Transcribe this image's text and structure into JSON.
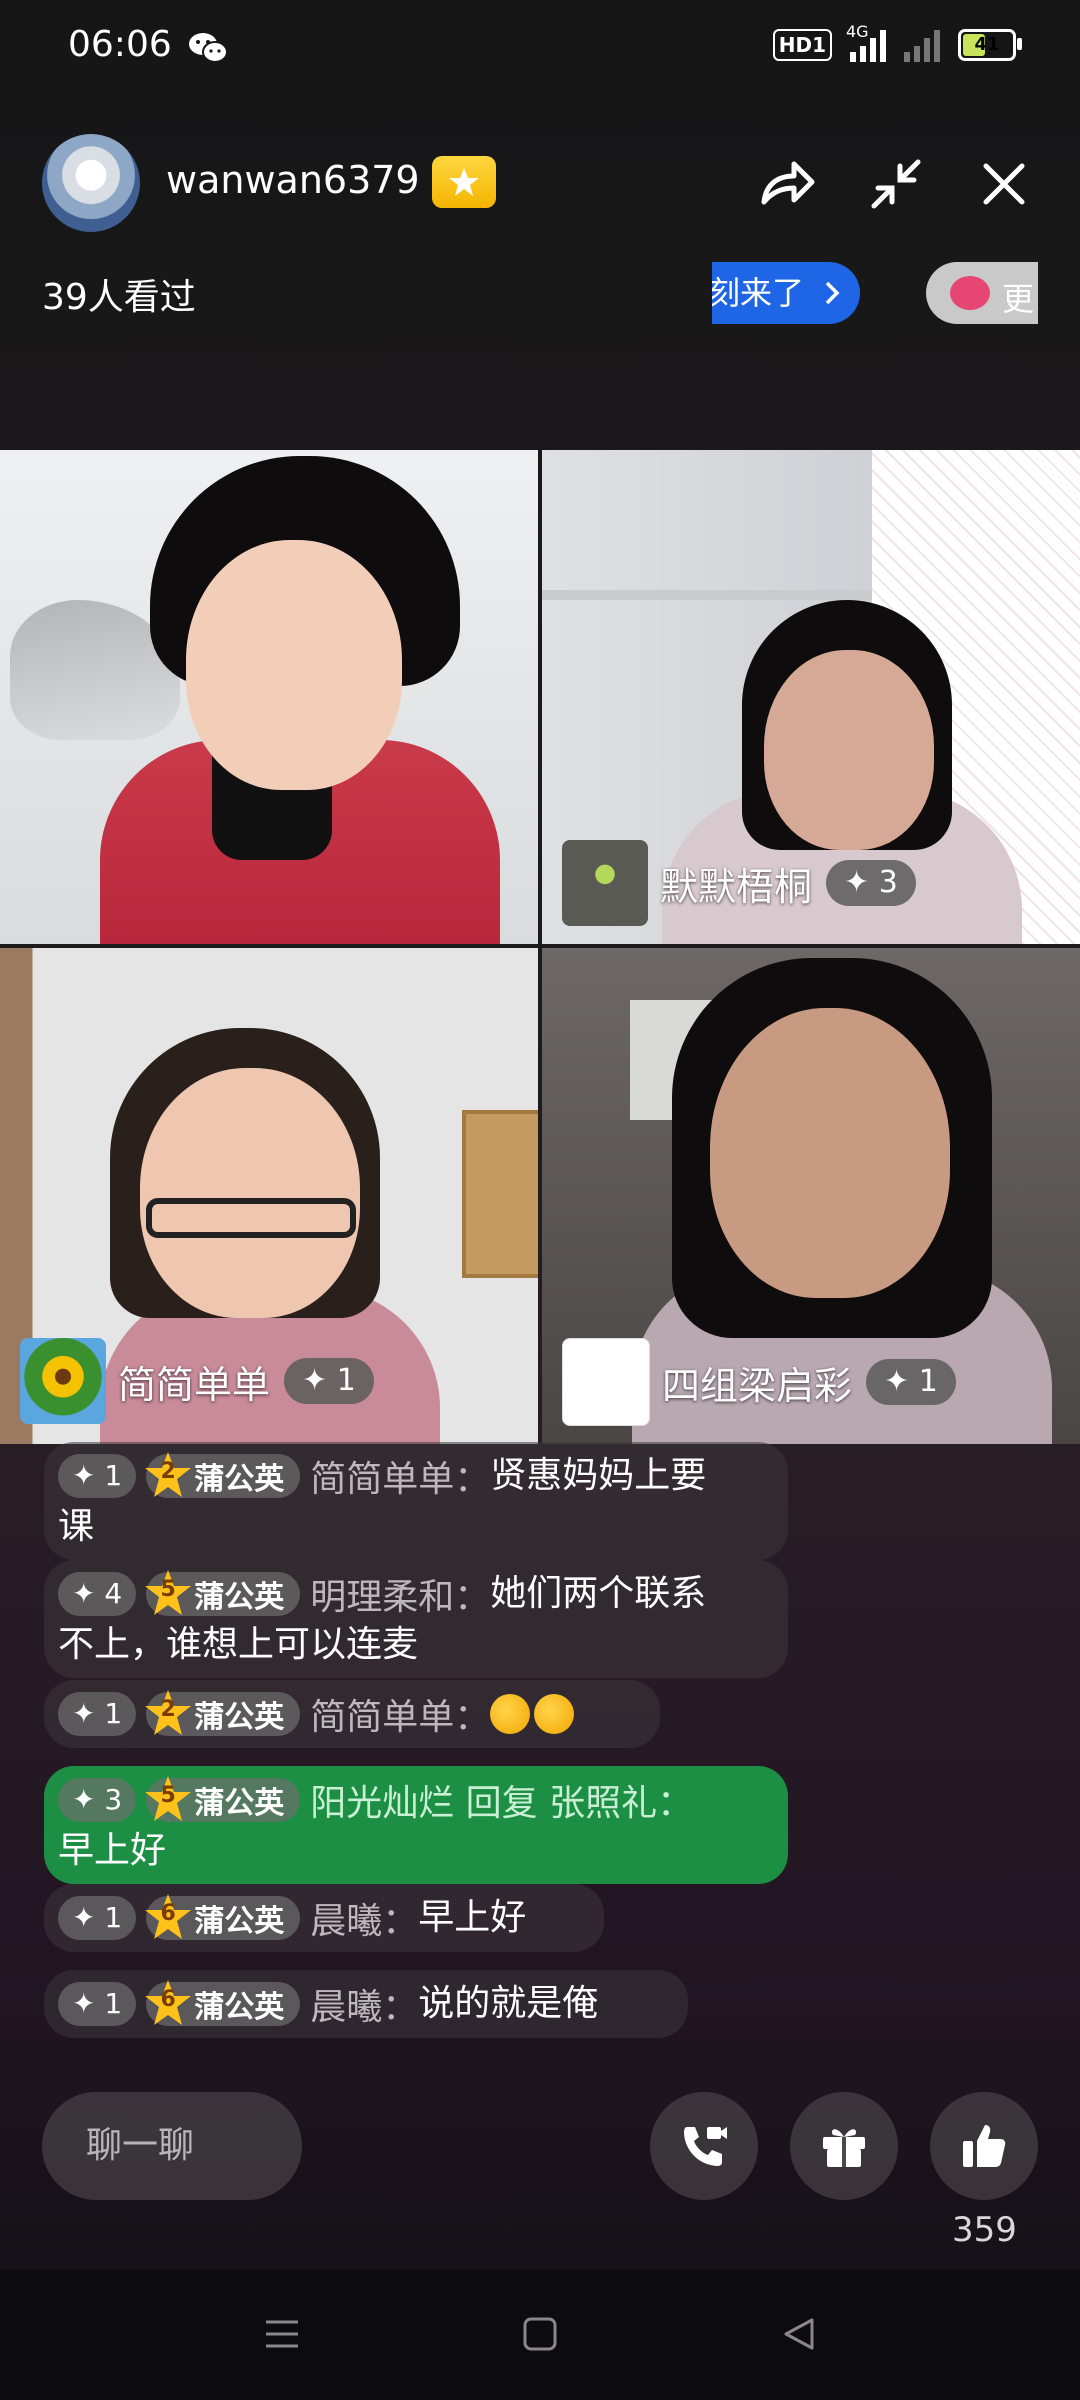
{
  "status_bar": {
    "time": "06:06",
    "wechat_icon": "wechat-icon",
    "hd_label": "HD1",
    "network_label": "4G",
    "battery": "41"
  },
  "host": {
    "name": "wanwan6379",
    "viewers": "39人看过",
    "badge_icon": "star-badge-icon"
  },
  "top_actions": {
    "share_icon": "share-icon",
    "minimize_icon": "minimize-icon",
    "close_icon": "close-icon"
  },
  "promos": {
    "blue": "刻来了",
    "gray": "更"
  },
  "participants": [
    {
      "name": "默默梧桐",
      "level": "3"
    },
    {
      "name": "简简单单",
      "level": "1"
    },
    {
      "name": "四组梁启彩",
      "level": "1"
    }
  ],
  "chat": [
    {
      "level": "1",
      "star": "2",
      "badge": "蒲公英",
      "user": "简简单单：",
      "text": "贤惠妈妈上要",
      "text2": "课"
    },
    {
      "level": "4",
      "star": "5",
      "badge": "蒲公英",
      "user": "明理柔和：",
      "text": "她们两个联系",
      "text2": "不上，谁想上可以连麦"
    },
    {
      "level": "1",
      "star": "2",
      "badge": "蒲公英",
      "user": "简简单单：",
      "text": ""
    },
    {
      "level": "3",
      "star": "5",
      "badge": "蒲公英",
      "user": "阳光灿烂 回复 张照礼：",
      "text": "",
      "text2": "早上好"
    },
    {
      "level": "1",
      "star": "6",
      "badge": "蒲公英",
      "user": "晨曦：",
      "text": "早上好"
    },
    {
      "level": "1",
      "star": "6",
      "badge": "蒲公英",
      "user": "晨曦：",
      "text": "说的就是俺"
    }
  ],
  "bottom": {
    "input_placeholder": "聊一聊",
    "call_icon": "video-call-icon",
    "gift_icon": "gift-icon",
    "like_icon": "thumbs-up-icon",
    "like_count": "359"
  },
  "nav": {
    "menu_icon": "menu-icon",
    "home_icon": "home-icon",
    "back_icon": "back-icon"
  }
}
